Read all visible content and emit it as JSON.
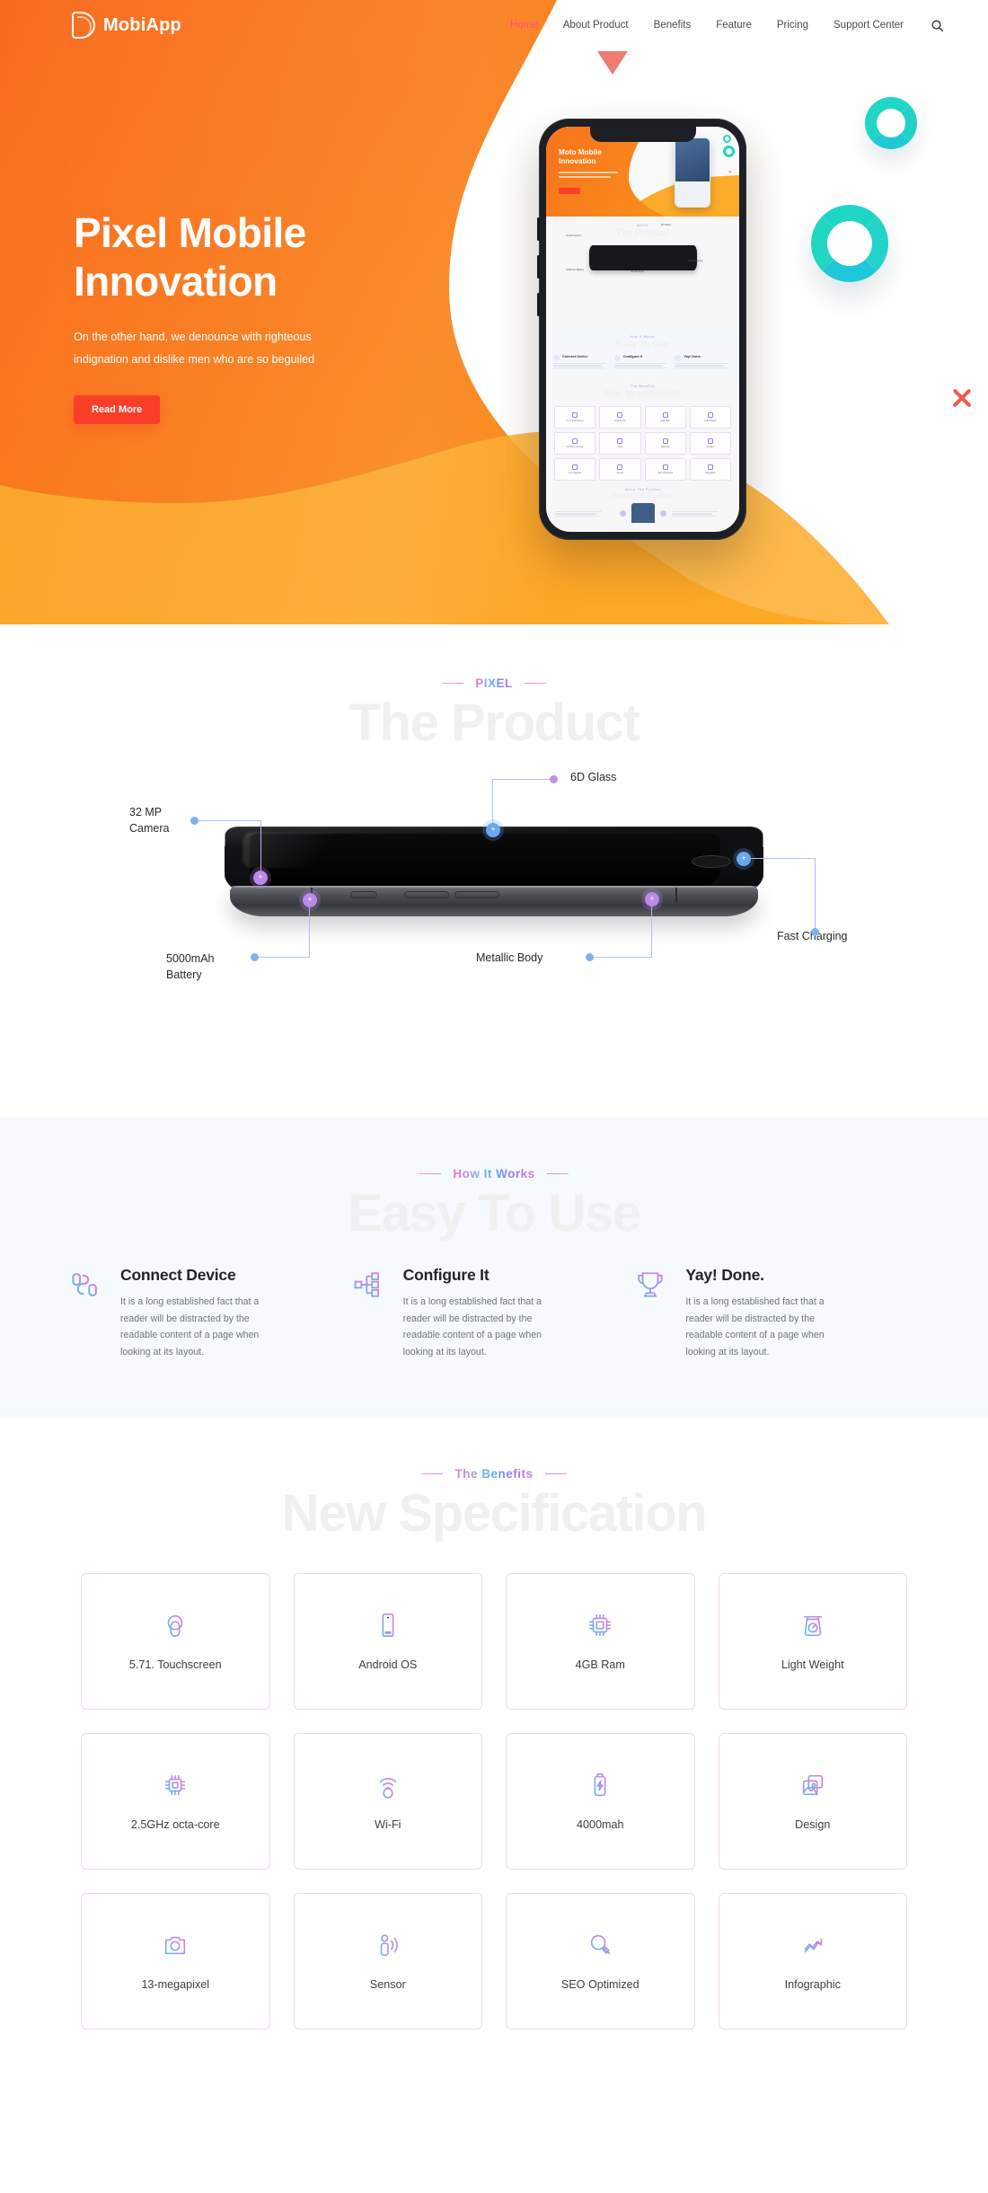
{
  "brand": {
    "name": "MobiApp",
    "logo_icon": "mobiapp-leaf-logo"
  },
  "nav": {
    "items": [
      {
        "label": "Home",
        "active": true
      },
      {
        "label": "About Product",
        "active": false
      },
      {
        "label": "Benefits",
        "active": false
      },
      {
        "label": "Feature",
        "active": false
      },
      {
        "label": "Pricing",
        "active": false
      },
      {
        "label": "Support Center",
        "active": false
      }
    ],
    "search_icon": "search-icon"
  },
  "hero": {
    "title_line1": "Pixel Mobile",
    "title_line2": "Innovation",
    "subtitle_line1": "On the other hand, we denounce with righteous",
    "subtitle_line2": "indignation and dislike men who are so beguiled",
    "cta_label": "Read More",
    "cta_color": "#fa3e28",
    "bg_gradient_from": "#f96b20",
    "bg_gradient_to": "#fca21c",
    "decor": {
      "triangle_color": "#ef7c72",
      "ring_color": "#1fd6c4",
      "x_color": "#f05b4b"
    },
    "phone_preview": {
      "title_line1": "Moto Mobile",
      "title_line2": "Innovation",
      "cta_label": "Read More",
      "sections": {
        "product_eyebrow": "MOTO",
        "product_heading": "The Product",
        "how_eyebrow": "How It Works",
        "how_heading": "Easy To Use",
        "how_items": [
          "Connect Device",
          "Configure It",
          "Yay! Done."
        ],
        "benefits_eyebrow": "The Benefits",
        "benefits_heading": "New Specification",
        "feature_eyebrow": "About The Product",
        "feature_heading": "Awesome Feature"
      },
      "callouts": [
        "32 MP Camera",
        "6D Glass",
        "5000mAh Battery",
        "Metallic Body",
        "Fast Charging"
      ]
    }
  },
  "product": {
    "eyebrow": "PIXEL",
    "ghost_heading": "The Product",
    "callouts": [
      {
        "label": "32 MP\nCamera",
        "pin": "purple",
        "dot": "blue"
      },
      {
        "label": "6D Glass",
        "pin": "blue",
        "dot": "purple"
      },
      {
        "label": "5000mAh\nBattery",
        "pin": "purple",
        "dot": "blue"
      },
      {
        "label": "Metallic Body",
        "pin": "purple",
        "dot": "blue"
      },
      {
        "label": "Fast Charging",
        "pin": "blue",
        "dot": "blue"
      }
    ]
  },
  "how": {
    "eyebrow": "How It Works",
    "ghost_heading": "Easy To Use",
    "bg_color": "#f6faff",
    "items": [
      {
        "icon": "connect-device-icon",
        "title": "Connect Device",
        "text": "It is a long established fact that a reader will be distracted by the readable content of a page when looking at its layout."
      },
      {
        "icon": "configure-sitemap-icon",
        "title": "Configure It",
        "text": "It is a long established fact that a reader will be distracted by the readable content of a page when looking at its layout."
      },
      {
        "icon": "trophy-icon",
        "title": "Yay! Done.",
        "text": "It is a long established fact that a reader will be distracted by the readable content of a page when looking at its layout."
      }
    ]
  },
  "benefits": {
    "eyebrow": "The Benefits",
    "ghost_heading": "New Specification",
    "card_border_color": "#f0d9f2",
    "cards": [
      {
        "icon": "touchscreen-icon",
        "label": "5.71. Touchscreen"
      },
      {
        "icon": "smartphone-icon",
        "label": "Android OS"
      },
      {
        "icon": "chip-icon",
        "label": "4GB Ram"
      },
      {
        "icon": "weight-scale-icon",
        "label": "Light Weight"
      },
      {
        "icon": "processor-icon",
        "label": "2.5GHz octa-core"
      },
      {
        "icon": "wifi-icon",
        "label": "Wi-Fi"
      },
      {
        "icon": "battery-icon",
        "label": "4000mah"
      },
      {
        "icon": "image-design-icon",
        "label": "Design"
      },
      {
        "icon": "camera-icon",
        "label": "13-megapixel"
      },
      {
        "icon": "sensor-icon",
        "label": "Sensor"
      },
      {
        "icon": "magnifier-icon",
        "label": "SEO Optimized"
      },
      {
        "icon": "chart-growth-icon",
        "label": "Infographic"
      }
    ]
  }
}
